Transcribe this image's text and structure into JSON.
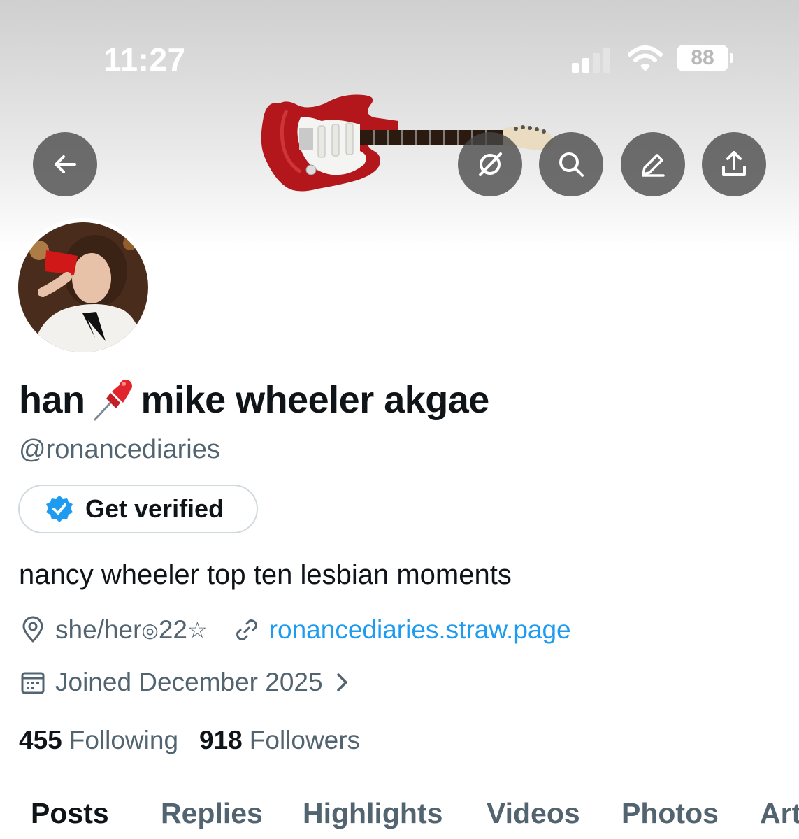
{
  "status_bar": {
    "time": "11:27",
    "battery": "88"
  },
  "header": {
    "buttons": [
      "back",
      "grok",
      "search",
      "edit",
      "share"
    ]
  },
  "profile": {
    "name_part1": "han",
    "name_part2": "mike wheeler akgae",
    "handle": "@ronancediaries",
    "verify_label": "Get verified",
    "bio": "nancy wheeler top ten lesbian moments",
    "location": "she/her ",
    "location_symbol1": "◎",
    "location_age": " 22 ",
    "location_symbol2": "☆",
    "website": "ronancediaries.straw.page",
    "joined": "Joined December 2025",
    "following_count": "455",
    "following_label": "Following",
    "followers_count": "918",
    "followers_label": "Followers"
  },
  "tabs": [
    "Posts",
    "Replies",
    "Highlights",
    "Videos",
    "Photos",
    "Art"
  ],
  "colors": {
    "link": "#1d9bf0",
    "secondary_text": "#536471",
    "verified_badge": "#1d9bf0",
    "pin": "#e0252c"
  }
}
